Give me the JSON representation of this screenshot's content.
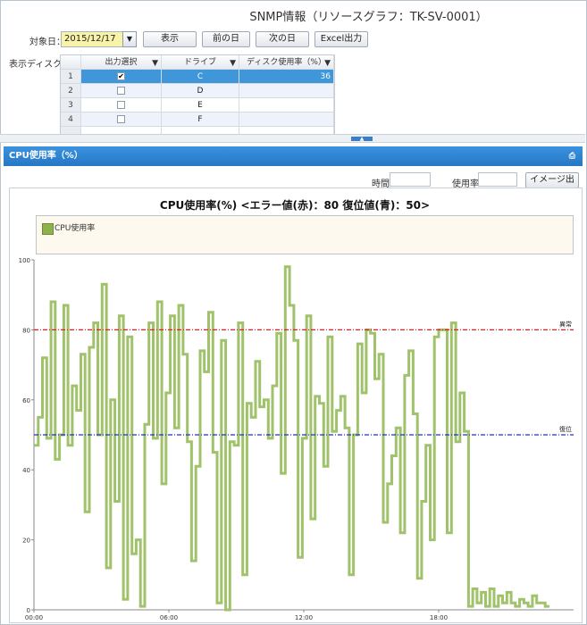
{
  "header": {
    "title": "SNMP情報（リソースグラフ：TK-SV-0001）"
  },
  "toolbar": {
    "date_label": "対象日：",
    "date_value": "2015/12/17",
    "show_button": "表示",
    "prev_day_button": "前の日",
    "next_day_button": "次の日",
    "excel_button": "Excel出力"
  },
  "disk_table": {
    "label": "表示ディスク：",
    "columns": [
      "出力選択",
      "ドライブ",
      "ディスク使用率（%）"
    ],
    "rows": [
      {
        "num": "1",
        "checked": true,
        "drive": "C",
        "usage": "36"
      },
      {
        "num": "2",
        "checked": false,
        "drive": "D",
        "usage": ""
      },
      {
        "num": "3",
        "checked": false,
        "drive": "E",
        "usage": ""
      },
      {
        "num": "4",
        "checked": false,
        "drive": "F",
        "usage": ""
      }
    ]
  },
  "panel": {
    "title": "CPU使用率（%）",
    "time_label": "時間",
    "time_value": "",
    "usage_label": "使用率",
    "usage_value": "",
    "image_export_button": "イメージ出力"
  },
  "chart_data": {
    "type": "line",
    "title": "CPU使用率(%) <エラー値(赤)：80 復位値(青)：50>",
    "xlabel": "",
    "ylabel": "",
    "ylim": [
      0,
      100
    ],
    "xlim": [
      0,
      24
    ],
    "x_ticks": [
      "00:00",
      "06:00",
      "12:00",
      "18:00"
    ],
    "y_ticks": [
      "0",
      "20",
      "40",
      "60",
      "80",
      "100"
    ],
    "legend": [
      "CPU使用率"
    ],
    "legend_position": "top",
    "series_color": "#9fc26b",
    "thresholds": [
      {
        "label": "異常",
        "value": 80,
        "color": "#e02020"
      },
      {
        "label": "復位",
        "value": 50,
        "color": "#2030c0"
      }
    ],
    "series": [
      {
        "name": "CPU使用率",
        "values": [
          47,
          55,
          72,
          49,
          88,
          43,
          50,
          87,
          47,
          64,
          57,
          73,
          28,
          75,
          82,
          50,
          93,
          12,
          60,
          31,
          84,
          3,
          78,
          16,
          20,
          1,
          53,
          82,
          49,
          88,
          36,
          62,
          84,
          52,
          87,
          73,
          48,
          14,
          41,
          74,
          68,
          85,
          45,
          2,
          77,
          0,
          48,
          47,
          82,
          10,
          59,
          55,
          71,
          58,
          60,
          49,
          64,
          79,
          39,
          98,
          87,
          77,
          15,
          49,
          84,
          26,
          61,
          59,
          41,
          78,
          51,
          57,
          61,
          52,
          10,
          50,
          76,
          62,
          80,
          79,
          66,
          73,
          25,
          36,
          44,
          52,
          22,
          67,
          74,
          56,
          9,
          31,
          47,
          20,
          78,
          80,
          80,
          22,
          82,
          48,
          62,
          51,
          1,
          6,
          2,
          5,
          1,
          6,
          1,
          4,
          2,
          5,
          2,
          1,
          3,
          2,
          1,
          4,
          2,
          2,
          1
        ]
      }
    ]
  }
}
